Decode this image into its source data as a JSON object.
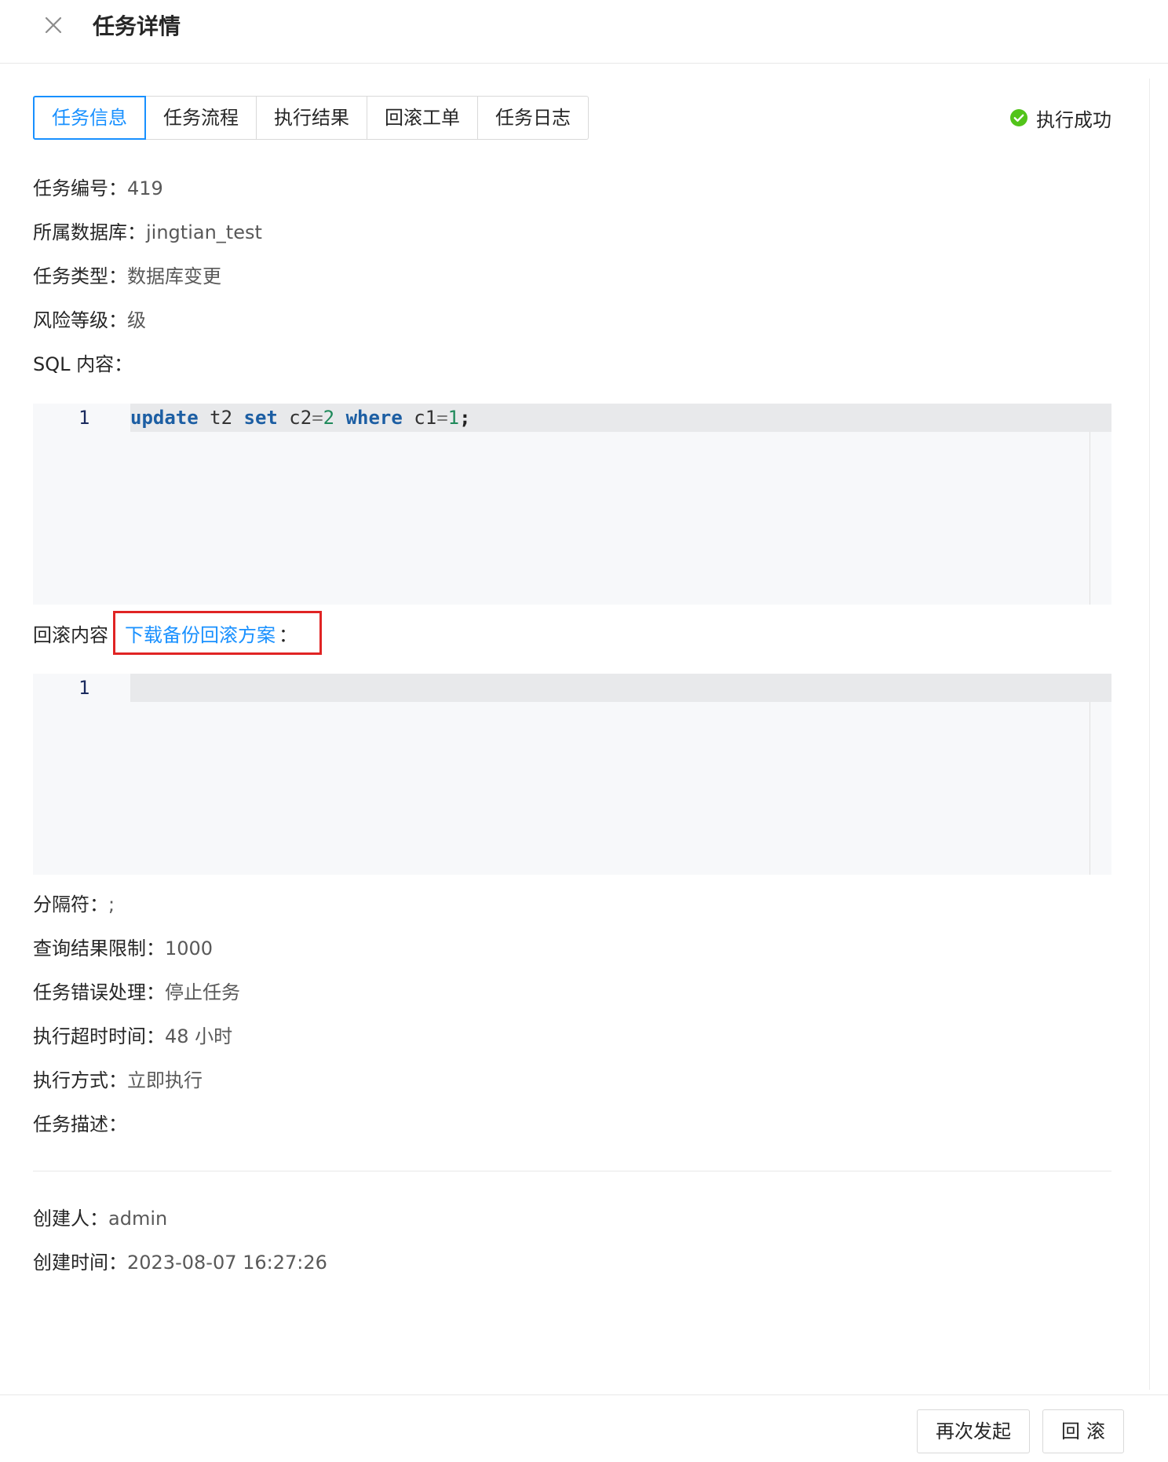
{
  "header": {
    "title": "任务详情",
    "close_icon": "close-icon"
  },
  "tabs": [
    {
      "label": "任务信息",
      "active": true
    },
    {
      "label": "任务流程",
      "active": false
    },
    {
      "label": "执行结果",
      "active": false
    },
    {
      "label": "回滚工单",
      "active": false
    },
    {
      "label": "任务日志",
      "active": false
    }
  ],
  "status": {
    "text": "执行成功",
    "icon": "check-circle-icon",
    "color": "#52c41a"
  },
  "info": {
    "task_id": {
      "label": "任务编号：",
      "value": "419"
    },
    "database": {
      "label": "所属数据库：",
      "value": "jingtian_test"
    },
    "task_type": {
      "label": "任务类型：",
      "value": "数据库变更"
    },
    "risk_level": {
      "label": "风险等级：",
      "value": "级"
    },
    "sql_content": {
      "label": "SQL 内容："
    }
  },
  "sql_editor": {
    "line_numbers": [
      "1"
    ],
    "tokens": [
      {
        "text": "update",
        "type": "kw"
      },
      {
        "text": " t2 ",
        "type": "plain"
      },
      {
        "text": "set",
        "type": "kw"
      },
      {
        "text": " c2",
        "type": "plain"
      },
      {
        "text": "=",
        "type": "op"
      },
      {
        "text": "2",
        "type": "num"
      },
      {
        "text": " ",
        "type": "plain"
      },
      {
        "text": "where",
        "type": "kw"
      },
      {
        "text": " c1",
        "type": "plain"
      },
      {
        "text": "=",
        "type": "op"
      },
      {
        "text": "1",
        "type": "num"
      },
      {
        "text": ";",
        "type": "punct"
      }
    ]
  },
  "rollback": {
    "label": "回滚内容",
    "link_text": "下载备份回滚方案",
    "colon": "：",
    "highlight_color": "#e02424"
  },
  "rollback_editor": {
    "line_numbers": [
      "1"
    ],
    "content": ""
  },
  "settings": {
    "delimiter": {
      "label": "分隔符：",
      "value": ";"
    },
    "query_limit": {
      "label": "查询结果限制：",
      "value": "1000"
    },
    "error_handling": {
      "label": "任务错误处理：",
      "value": "停止任务"
    },
    "timeout": {
      "label": "执行超时时间：",
      "value": "48 小时"
    },
    "exec_mode": {
      "label": "执行方式：",
      "value": "立即执行"
    },
    "description": {
      "label": "任务描述：",
      "value": ""
    }
  },
  "meta": {
    "creator": {
      "label": "创建人：",
      "value": "admin"
    },
    "created_at": {
      "label": "创建时间：",
      "value": "2023-08-07 16:27:26"
    }
  },
  "footer": {
    "relaunch_label": "再次发起",
    "rollback_label": "回滚"
  },
  "colors": {
    "primary": "#1890ff",
    "success": "#52c41a",
    "code_bg": "#f7f8fa",
    "active_line_bg": "#e8e9eb"
  }
}
